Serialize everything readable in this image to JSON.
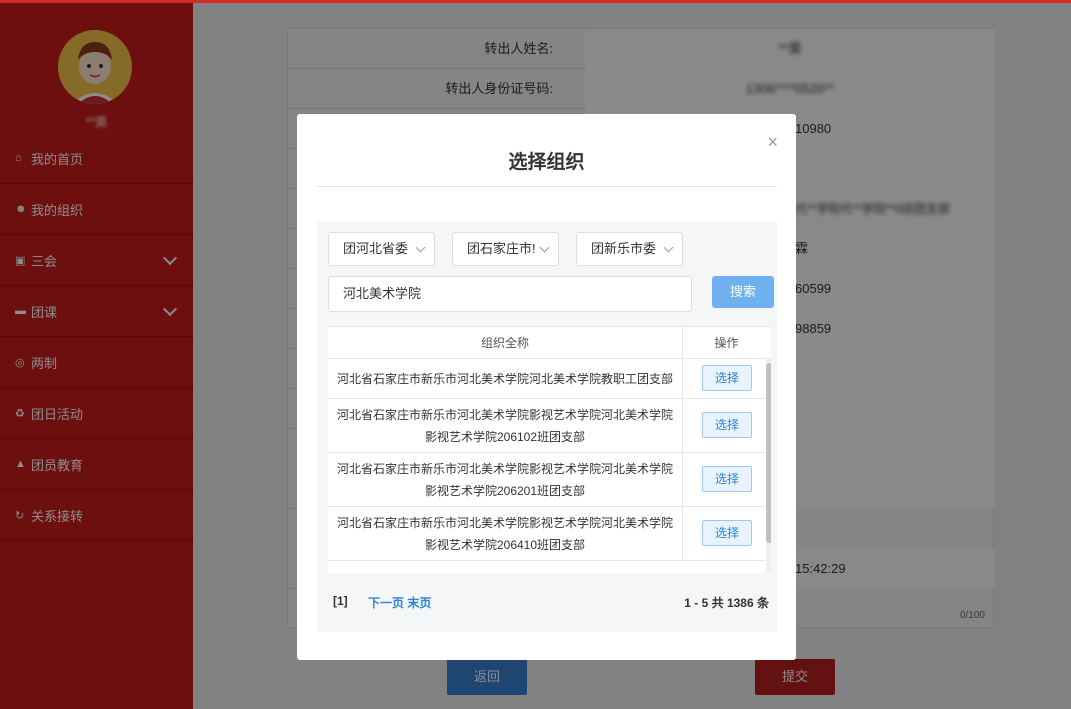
{
  "sidebar": {
    "user_name": "**莫",
    "items": [
      {
        "icon": "home-icon",
        "glyph": "⌂",
        "label": "我的首页"
      },
      {
        "icon": "group-icon",
        "glyph": "☻",
        "label": "我的组织"
      },
      {
        "icon": "edit-icon",
        "glyph": "▣",
        "label": "三会"
      },
      {
        "icon": "folder-icon",
        "glyph": "▬",
        "label": "团课"
      },
      {
        "icon": "target-icon",
        "glyph": "◎",
        "label": "两制"
      },
      {
        "icon": "recycle-icon",
        "glyph": "♻",
        "label": "团日活动"
      },
      {
        "icon": "graduation-icon",
        "glyph": "▲",
        "label": "团员教育"
      },
      {
        "icon": "refresh-icon",
        "glyph": "↻",
        "label": "关系接转"
      }
    ]
  },
  "form": {
    "row1": {
      "label": "转出人姓名:",
      "value": "**莫"
    },
    "row2": {
      "label": "转出人身份证号码:",
      "value": "1306****0520**"
    },
    "row3_value": "10980",
    "row5_value": "代**学院代**学院**0班团支部",
    "row6_value": "霖",
    "row7_value": "60599",
    "row8_value": "98859",
    "time_value": "15:42:29",
    "counter": "0/100",
    "back_label": "返回",
    "submit_label": "提交"
  },
  "modal": {
    "close_glyph": "×",
    "title": "选择组织",
    "selects": [
      "团河北省委",
      "团石家庄市!",
      "团新乐市委"
    ],
    "keyword": "河北美术学院",
    "search_label": "搜索",
    "table": {
      "header_name": "组织全称",
      "header_op": "操作",
      "rows": [
        {
          "name": "河北省石家庄市新乐市河北美术学院河北美术学院教职工团支部",
          "action": "选择"
        },
        {
          "name": "河北省石家庄市新乐市河北美术学院影视艺术学院河北美术学院影视艺术学院206102班团支部",
          "action": "选择"
        },
        {
          "name": "河北省石家庄市新乐市河北美术学院影视艺术学院河北美术学院影视艺术学院206201班团支部",
          "action": "选择"
        },
        {
          "name": "河北省石家庄市新乐市河北美术学院影视艺术学院河北美术学院影视艺术学院206410班团支部",
          "action": "选择"
        }
      ]
    },
    "pager": {
      "current": "[1]",
      "next_last": "下一页 末页",
      "summary": "1 - 5 共 1386 条"
    }
  }
}
